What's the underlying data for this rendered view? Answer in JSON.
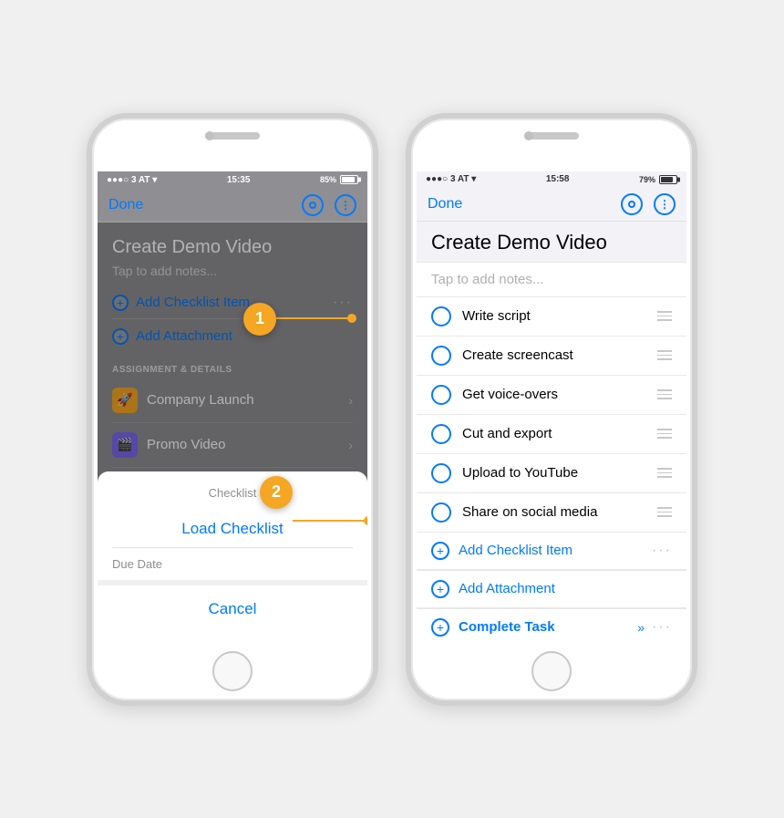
{
  "phone1": {
    "status": {
      "left": "●●●○ 3 AT ▾",
      "center": "15:35",
      "right": "85%"
    },
    "nav": {
      "done": "Done"
    },
    "task": {
      "title": "Create Demo Video",
      "notes_placeholder": "Tap to add notes...",
      "add_checklist": "Add Checklist Item",
      "add_attachment": "Add Attachment"
    },
    "section_label": "ASSIGNMENT & DETAILS",
    "details": [
      {
        "label": "Company Launch",
        "icon": "🚀"
      },
      {
        "label": "Promo Video",
        "icon": "🎬"
      }
    ],
    "modal": {
      "header": "Checklist",
      "action": "Load Checklist",
      "due": "Due Date",
      "cancel": "Cancel"
    },
    "annotation1": "1",
    "annotation2": "2"
  },
  "phone2": {
    "status": {
      "left": "●●●○ 3 AT ▾",
      "center": "15:58",
      "right": "79%"
    },
    "nav": {
      "done": "Done"
    },
    "task": {
      "title": "Create Demo Video",
      "notes_placeholder": "Tap to add notes..."
    },
    "checklist": [
      "Write script",
      "Create screencast",
      "Get voice-overs",
      "Cut and export",
      "Upload to YouTube",
      "Share on social media"
    ],
    "add_checklist": "Add Checklist Item",
    "add_attachment": "Add Attachment",
    "complete_task": "Complete Task"
  }
}
